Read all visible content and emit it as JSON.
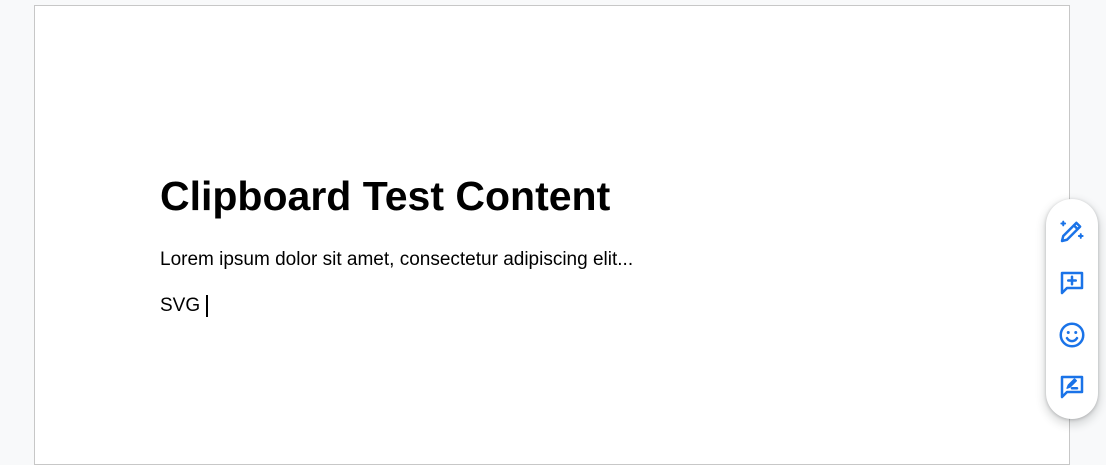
{
  "document": {
    "title": "Clipboard Test Content",
    "paragraph": "Lorem ipsum dolor sit amet, consectetur adipiscing elit...",
    "line": "SVG"
  },
  "side_toolbar": {
    "icons": [
      "ai-edit-pencil-icon",
      "add-comment-icon",
      "add-emoji-reaction-icon",
      "suggest-edits-icon"
    ],
    "accent_color": "#1a73e8"
  }
}
